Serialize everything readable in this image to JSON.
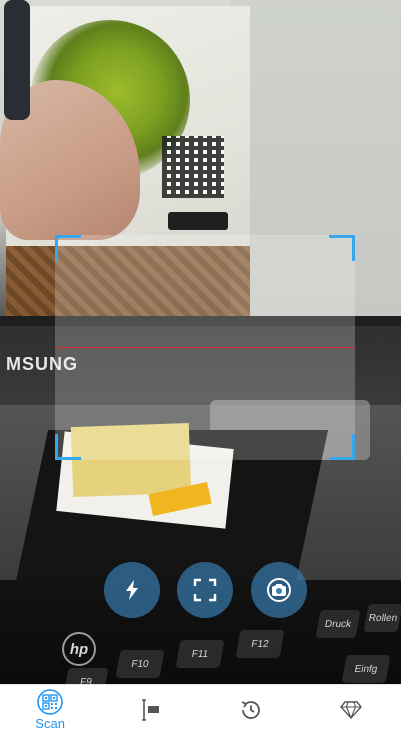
{
  "camera": {
    "scene_text": {
      "monitor_brand": "MSUNG",
      "keyboard_brand": "hp"
    },
    "keys": [
      "F9",
      "F10",
      "F11",
      "F12",
      "Druck",
      "Rollen",
      "Einfg"
    ]
  },
  "controls": [
    {
      "name": "flash-button",
      "icon": "flash-icon"
    },
    {
      "name": "fit-frame-button",
      "icon": "frame-corners-icon"
    },
    {
      "name": "switch-camera-button",
      "icon": "camera-switch-icon"
    }
  ],
  "nav": {
    "items": [
      {
        "label": "Scan",
        "icon": "qr-code-icon",
        "active": true
      },
      {
        "label": "",
        "icon": "barcode-icon",
        "active": false
      },
      {
        "label": "",
        "icon": "history-icon",
        "active": false
      },
      {
        "label": "",
        "icon": "diamond-icon",
        "active": false
      }
    ],
    "active_color": "#2196f3",
    "inactive_color": "#555555"
  },
  "overlay": {
    "frame_color": "#38a8ee",
    "laser_color": "#e62828"
  }
}
